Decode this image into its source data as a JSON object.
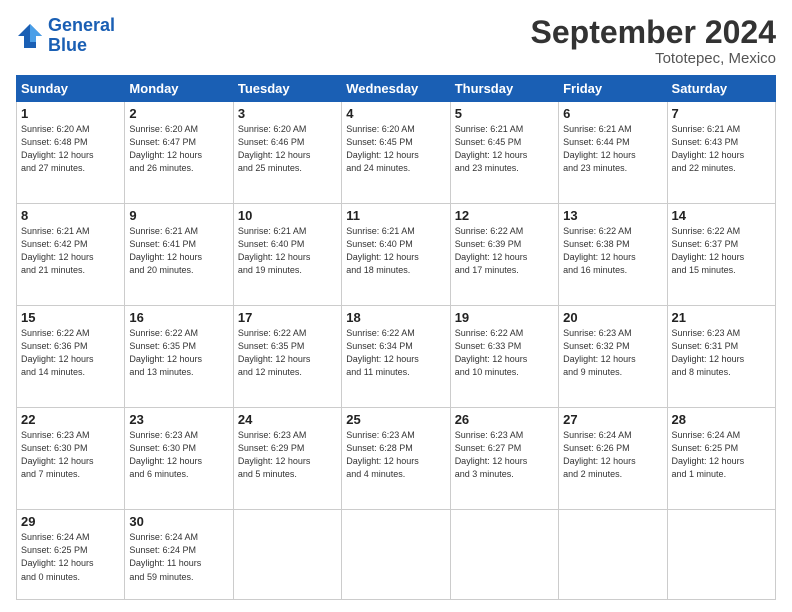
{
  "logo": {
    "line1": "General",
    "line2": "Blue"
  },
  "title": "September 2024",
  "subtitle": "Tototepec, Mexico",
  "days_header": [
    "Sunday",
    "Monday",
    "Tuesday",
    "Wednesday",
    "Thursday",
    "Friday",
    "Saturday"
  ],
  "weeks": [
    [
      {
        "day": "1",
        "info": "Sunrise: 6:20 AM\nSunset: 6:48 PM\nDaylight: 12 hours\nand 27 minutes."
      },
      {
        "day": "2",
        "info": "Sunrise: 6:20 AM\nSunset: 6:47 PM\nDaylight: 12 hours\nand 26 minutes."
      },
      {
        "day": "3",
        "info": "Sunrise: 6:20 AM\nSunset: 6:46 PM\nDaylight: 12 hours\nand 25 minutes."
      },
      {
        "day": "4",
        "info": "Sunrise: 6:20 AM\nSunset: 6:45 PM\nDaylight: 12 hours\nand 24 minutes."
      },
      {
        "day": "5",
        "info": "Sunrise: 6:21 AM\nSunset: 6:45 PM\nDaylight: 12 hours\nand 23 minutes."
      },
      {
        "day": "6",
        "info": "Sunrise: 6:21 AM\nSunset: 6:44 PM\nDaylight: 12 hours\nand 23 minutes."
      },
      {
        "day": "7",
        "info": "Sunrise: 6:21 AM\nSunset: 6:43 PM\nDaylight: 12 hours\nand 22 minutes."
      }
    ],
    [
      {
        "day": "8",
        "info": "Sunrise: 6:21 AM\nSunset: 6:42 PM\nDaylight: 12 hours\nand 21 minutes."
      },
      {
        "day": "9",
        "info": "Sunrise: 6:21 AM\nSunset: 6:41 PM\nDaylight: 12 hours\nand 20 minutes."
      },
      {
        "day": "10",
        "info": "Sunrise: 6:21 AM\nSunset: 6:40 PM\nDaylight: 12 hours\nand 19 minutes."
      },
      {
        "day": "11",
        "info": "Sunrise: 6:21 AM\nSunset: 6:40 PM\nDaylight: 12 hours\nand 18 minutes."
      },
      {
        "day": "12",
        "info": "Sunrise: 6:22 AM\nSunset: 6:39 PM\nDaylight: 12 hours\nand 17 minutes."
      },
      {
        "day": "13",
        "info": "Sunrise: 6:22 AM\nSunset: 6:38 PM\nDaylight: 12 hours\nand 16 minutes."
      },
      {
        "day": "14",
        "info": "Sunrise: 6:22 AM\nSunset: 6:37 PM\nDaylight: 12 hours\nand 15 minutes."
      }
    ],
    [
      {
        "day": "15",
        "info": "Sunrise: 6:22 AM\nSunset: 6:36 PM\nDaylight: 12 hours\nand 14 minutes."
      },
      {
        "day": "16",
        "info": "Sunrise: 6:22 AM\nSunset: 6:35 PM\nDaylight: 12 hours\nand 13 minutes."
      },
      {
        "day": "17",
        "info": "Sunrise: 6:22 AM\nSunset: 6:35 PM\nDaylight: 12 hours\nand 12 minutes."
      },
      {
        "day": "18",
        "info": "Sunrise: 6:22 AM\nSunset: 6:34 PM\nDaylight: 12 hours\nand 11 minutes."
      },
      {
        "day": "19",
        "info": "Sunrise: 6:22 AM\nSunset: 6:33 PM\nDaylight: 12 hours\nand 10 minutes."
      },
      {
        "day": "20",
        "info": "Sunrise: 6:23 AM\nSunset: 6:32 PM\nDaylight: 12 hours\nand 9 minutes."
      },
      {
        "day": "21",
        "info": "Sunrise: 6:23 AM\nSunset: 6:31 PM\nDaylight: 12 hours\nand 8 minutes."
      }
    ],
    [
      {
        "day": "22",
        "info": "Sunrise: 6:23 AM\nSunset: 6:30 PM\nDaylight: 12 hours\nand 7 minutes."
      },
      {
        "day": "23",
        "info": "Sunrise: 6:23 AM\nSunset: 6:30 PM\nDaylight: 12 hours\nand 6 minutes."
      },
      {
        "day": "24",
        "info": "Sunrise: 6:23 AM\nSunset: 6:29 PM\nDaylight: 12 hours\nand 5 minutes."
      },
      {
        "day": "25",
        "info": "Sunrise: 6:23 AM\nSunset: 6:28 PM\nDaylight: 12 hours\nand 4 minutes."
      },
      {
        "day": "26",
        "info": "Sunrise: 6:23 AM\nSunset: 6:27 PM\nDaylight: 12 hours\nand 3 minutes."
      },
      {
        "day": "27",
        "info": "Sunrise: 6:24 AM\nSunset: 6:26 PM\nDaylight: 12 hours\nand 2 minutes."
      },
      {
        "day": "28",
        "info": "Sunrise: 6:24 AM\nSunset: 6:25 PM\nDaylight: 12 hours\nand 1 minute."
      }
    ],
    [
      {
        "day": "29",
        "info": "Sunrise: 6:24 AM\nSunset: 6:25 PM\nDaylight: 12 hours\nand 0 minutes."
      },
      {
        "day": "30",
        "info": "Sunrise: 6:24 AM\nSunset: 6:24 PM\nDaylight: 11 hours\nand 59 minutes."
      },
      {
        "day": "",
        "info": ""
      },
      {
        "day": "",
        "info": ""
      },
      {
        "day": "",
        "info": ""
      },
      {
        "day": "",
        "info": ""
      },
      {
        "day": "",
        "info": ""
      }
    ]
  ]
}
